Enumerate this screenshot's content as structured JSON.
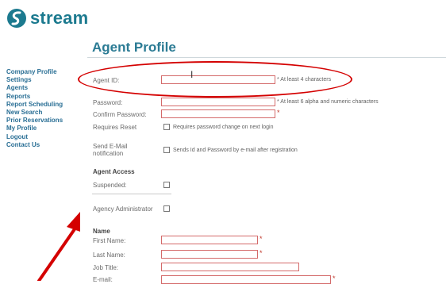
{
  "brand": {
    "name": "stream",
    "accent": "#1c7a8f"
  },
  "page": {
    "title": "Agent Profile"
  },
  "sidebar": {
    "items": [
      {
        "label": "Company Profile"
      },
      {
        "label": "Settings"
      },
      {
        "label": "Agents"
      },
      {
        "label": "Reports"
      },
      {
        "label": "Report Scheduling"
      },
      {
        "label": "New Search"
      },
      {
        "label": "Prior Reservations"
      },
      {
        "label": "My Profile"
      },
      {
        "label": "Logout"
      },
      {
        "label": "Contact Us"
      }
    ]
  },
  "form": {
    "agent_id": {
      "label": "Agent ID:",
      "value": "",
      "hint": "* At least 4 characters"
    },
    "password": {
      "label": "Password:",
      "value": "",
      "hint": "* At least 6 alpha and numeric characters"
    },
    "confirm_password": {
      "label": "Confirm Password:",
      "value": "",
      "req": "*"
    },
    "requires_reset": {
      "label": "Requires Reset",
      "checked": false,
      "hint": "Requires password change on next login"
    },
    "send_email": {
      "label_line1": "Send E-Mail",
      "label_line2": "notification",
      "checked": false,
      "hint": "Sends Id and Password by e-mail after registration"
    },
    "agent_access": {
      "heading": "Agent Access",
      "suspended": {
        "label": "Suspended:",
        "checked": false
      },
      "agency_admin": {
        "label": "Agency Administrator",
        "checked": false
      }
    },
    "name": {
      "heading": "Name",
      "first_name": {
        "label": "First Name:",
        "value": "",
        "req": "*"
      },
      "last_name": {
        "label": "Last Name:",
        "value": "",
        "req": "*"
      },
      "job_title": {
        "label": "Job Title:",
        "value": ""
      },
      "email": {
        "label": "E-mail:",
        "value": "",
        "req": "*"
      }
    }
  },
  "annotation": {
    "highlight_color": "#d40000"
  }
}
